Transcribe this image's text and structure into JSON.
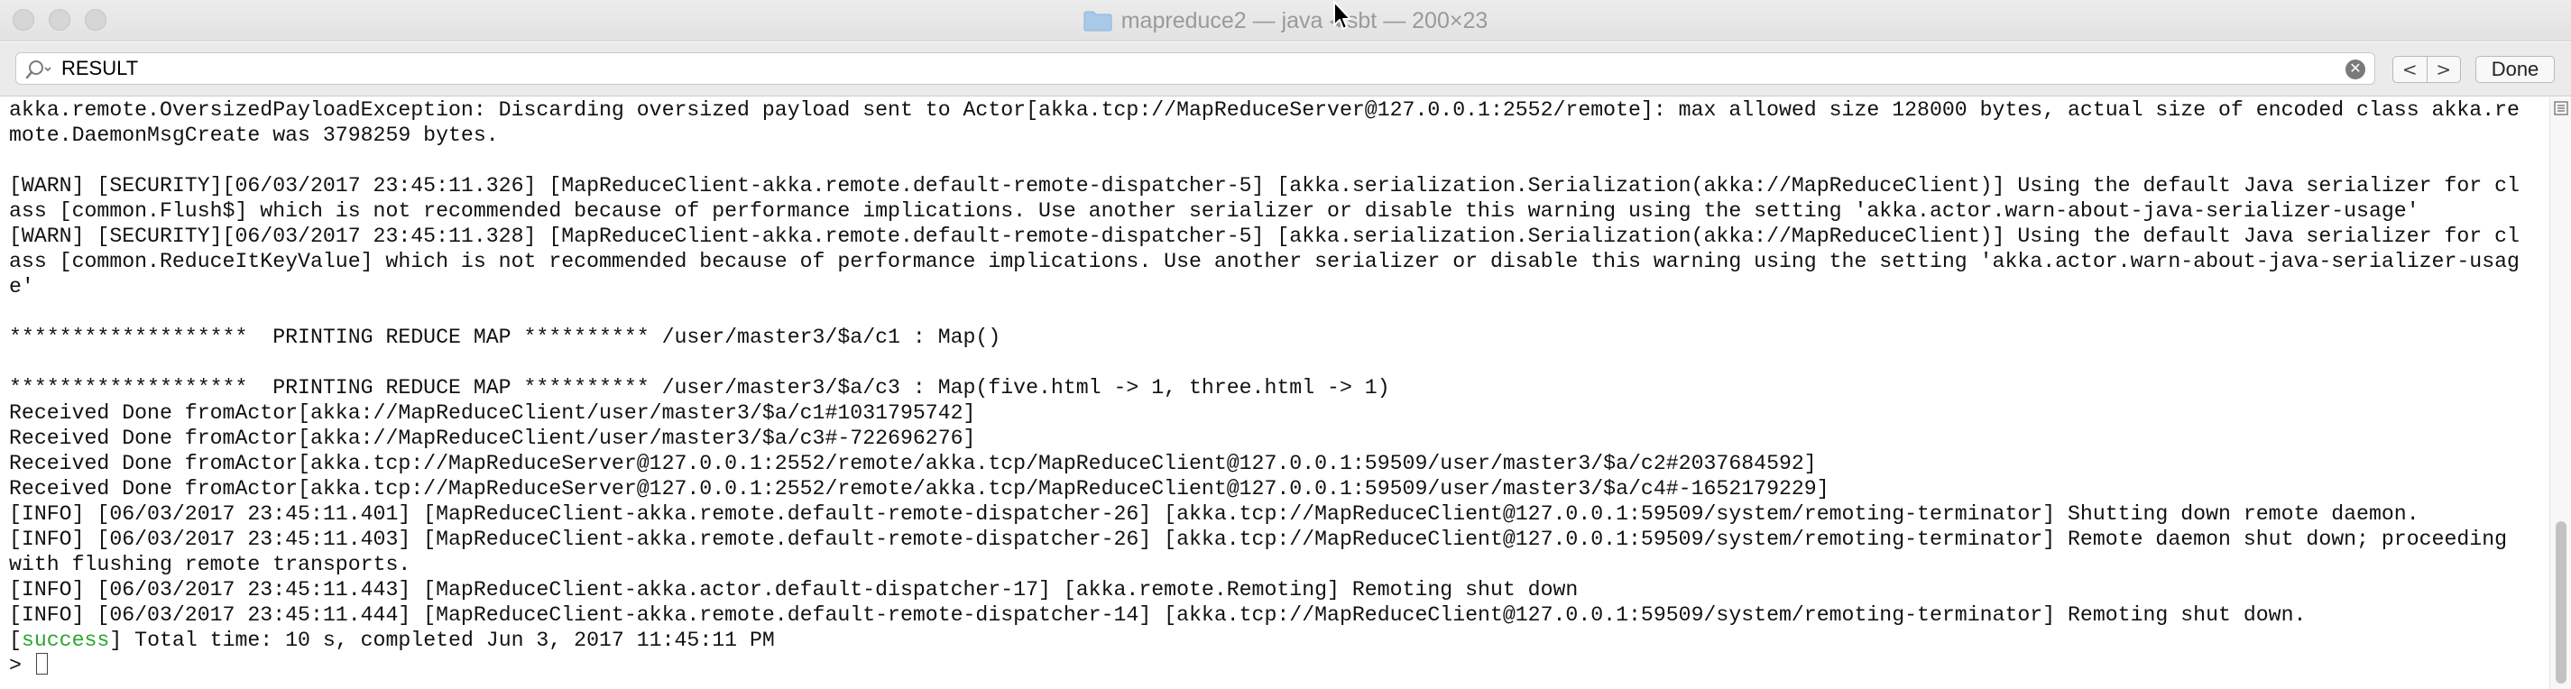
{
  "window": {
    "title": "mapreduce2 — java ◂ sbt — 200×23"
  },
  "find": {
    "value": "RESULT",
    "done_label": "Done",
    "prev_label": "<",
    "next_label": ">"
  },
  "terminal": {
    "lines": [
      "akka.remote.OversizedPayloadException: Discarding oversized payload sent to Actor[akka.tcp://MapReduceServer@127.0.0.1:2552/remote]: max allowed size 128000 bytes, actual size of encoded class akka.re",
      "mote.DaemonMsgCreate was 3798259 bytes.",
      "",
      "[WARN] [SECURITY][06/03/2017 23:45:11.326] [MapReduceClient-akka.remote.default-remote-dispatcher-5] [akka.serialization.Serialization(akka://MapReduceClient)] Using the default Java serializer for cl",
      "ass [common.Flush$] which is not recommended because of performance implications. Use another serializer or disable this warning using the setting 'akka.actor.warn-about-java-serializer-usage'",
      "[WARN] [SECURITY][06/03/2017 23:45:11.328] [MapReduceClient-akka.remote.default-remote-dispatcher-5] [akka.serialization.Serialization(akka://MapReduceClient)] Using the default Java serializer for cl",
      "ass [common.ReduceItKeyValue] which is not recommended because of performance implications. Use another serializer or disable this warning using the setting 'akka.actor.warn-about-java-serializer-usag",
      "e'",
      "",
      "*******************  PRINTING REDUCE MAP ********** /user/master3/$a/c1 : Map()",
      "",
      "*******************  PRINTING REDUCE MAP ********** /user/master3/$a/c3 : Map(five.html -> 1, three.html -> 1)",
      "Received Done fromActor[akka://MapReduceClient/user/master3/$a/c1#1031795742]",
      "Received Done fromActor[akka://MapReduceClient/user/master3/$a/c3#-722696276]",
      "Received Done fromActor[akka.tcp://MapReduceServer@127.0.0.1:2552/remote/akka.tcp/MapReduceClient@127.0.0.1:59509/user/master3/$a/c2#2037684592]",
      "Received Done fromActor[akka.tcp://MapReduceServer@127.0.0.1:2552/remote/akka.tcp/MapReduceClient@127.0.0.1:59509/user/master3/$a/c4#-1652179229]",
      "[INFO] [06/03/2017 23:45:11.401] [MapReduceClient-akka.remote.default-remote-dispatcher-26] [akka.tcp://MapReduceClient@127.0.0.1:59509/system/remoting-terminator] Shutting down remote daemon.",
      "[INFO] [06/03/2017 23:45:11.403] [MapReduceClient-akka.remote.default-remote-dispatcher-26] [akka.tcp://MapReduceClient@127.0.0.1:59509/system/remoting-terminator] Remote daemon shut down; proceeding",
      "with flushing remote transports.",
      "[INFO] [06/03/2017 23:45:11.443] [MapReduceClient-akka.actor.default-dispatcher-17] [akka.remote.Remoting] Remoting shut down",
      "[INFO] [06/03/2017 23:45:11.444] [MapReduceClient-akka.remote.default-remote-dispatcher-14] [akka.tcp://MapReduceClient@127.0.0.1:59509/system/remoting-terminator] Remoting shut down."
    ],
    "success_tag": "success",
    "success_rest": " Total time: 10 s, completed Jun 3, 2017 11:45:11 PM",
    "prompt": ">"
  },
  "colors": {
    "success": "#2ea62e",
    "text": "#111111"
  }
}
